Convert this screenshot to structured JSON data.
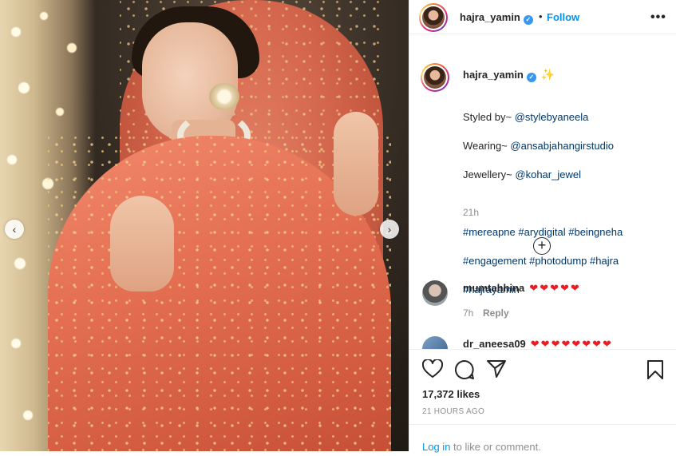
{
  "header": {
    "username": "hajra_yamin",
    "verified_mark": "✓",
    "separator": "•",
    "follow_label": "Follow",
    "more_label": "•••"
  },
  "caption": {
    "username": "hajra_yamin",
    "emoji": "✨",
    "lines": [
      {
        "prefix": "Styled by~ ",
        "link": "@stylebyaneela"
      },
      {
        "prefix": "Wearing~ ",
        "link": "@ansabjahangirstudio"
      },
      {
        "prefix": "Jewellery~ ",
        "link": "@kohar_jewel"
      }
    ],
    "hashtags": [
      "#mereapne #arydigital #beingneha",
      "#engagement #photodump #hajra",
      "#hajrayamin"
    ],
    "time": "21h"
  },
  "load_more_label": "+",
  "comments": [
    {
      "username": "mumtahhina",
      "text": "❤❤❤❤❤",
      "time": "7h",
      "reply_label": "Reply"
    },
    {
      "username": "dr_aneesa09",
      "text": "❤❤❤❤❤❤❤❤"
    }
  ],
  "media": {
    "prev_label": "‹",
    "next_label": "›"
  },
  "actions": {
    "likes": "17,372 likes",
    "timestamp": "21 HOURS AGO",
    "login_link": "Log in",
    "login_suffix": " to like or comment."
  },
  "colors": {
    "follow": "#0095f6",
    "link": "#00376b",
    "verified": "#3897f0",
    "heart": "#ed1c24",
    "dupatta": "#e06a4f"
  },
  "icons": [
    "like-icon",
    "comment-icon",
    "share-icon",
    "save-icon",
    "plus-circle-icon",
    "chevron-left-icon",
    "chevron-right-icon",
    "verified-icon",
    "more-icon"
  ]
}
